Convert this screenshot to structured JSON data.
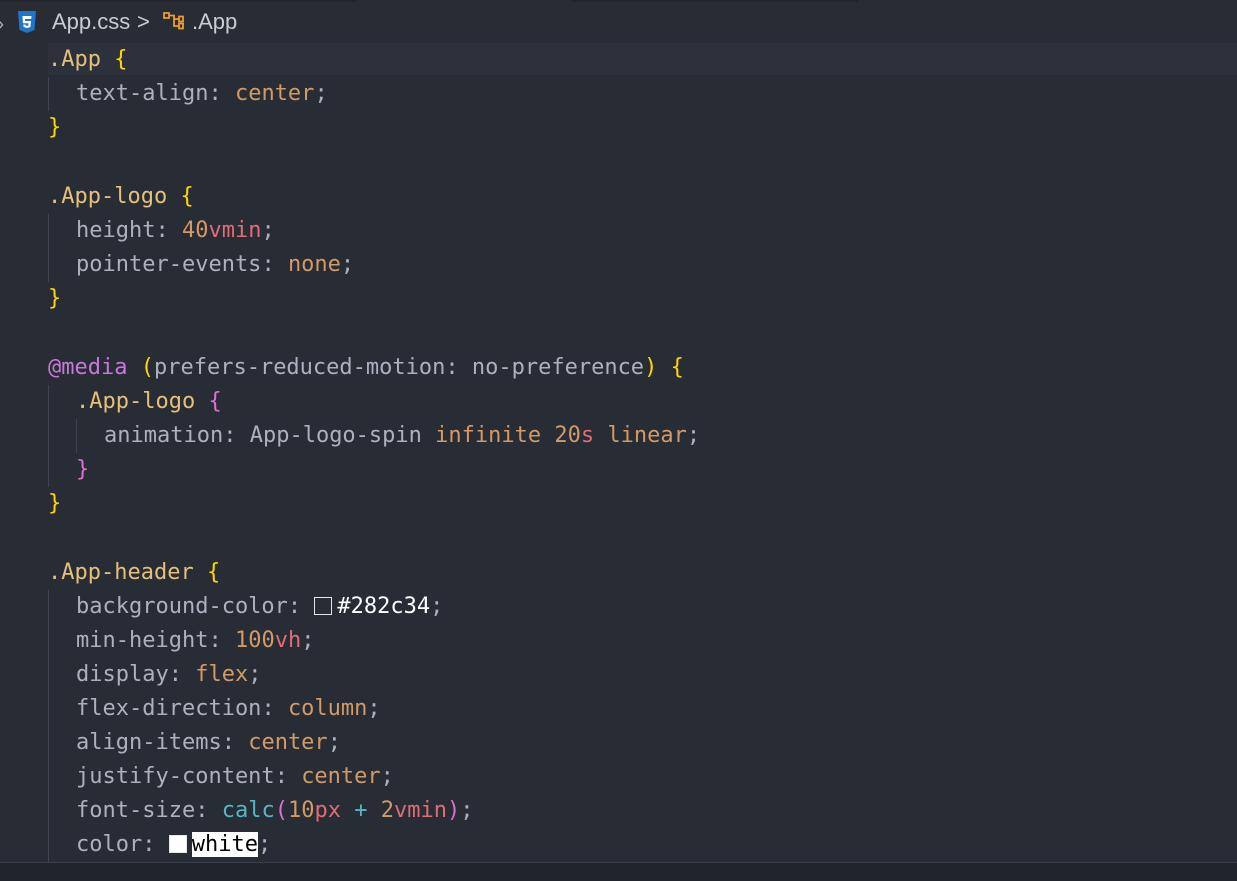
{
  "breadcrumb": {
    "file": "App.css",
    "separator": ">",
    "symbol": ".App"
  },
  "icons": {
    "file_icon": "css3-icon",
    "symbol_icon": "symbol-class-icon",
    "chevron": "chevron-right-icon"
  },
  "colors": {
    "background": "#282c34",
    "selector": "#e5c07b",
    "value": "#d19a66",
    "unit": "#e06c75",
    "at_rule": "#c678dd",
    "function": "#56b6c2",
    "bracket_level1": "#ffd700",
    "bracket_level2": "#da70d6",
    "css_badge": "#1f75c9"
  },
  "code": {
    "l1": [
      ".App",
      " ",
      "{"
    ],
    "l2": [
      "text-align",
      ": ",
      "center",
      ";"
    ],
    "l3": [
      "}"
    ],
    "l5": [
      ".App-logo",
      " ",
      "{"
    ],
    "l6": [
      "height",
      ": ",
      "40",
      "vmin",
      ";"
    ],
    "l7": [
      "pointer-events",
      ": ",
      "none",
      ";"
    ],
    "l8": [
      "}"
    ],
    "l10": [
      "@media",
      " ",
      "(",
      "prefers-reduced-motion: no-preference",
      ")",
      " ",
      "{"
    ],
    "l11": [
      ".App-logo",
      " ",
      "{"
    ],
    "l12": [
      "animation",
      ": ",
      "App-logo-spin",
      " ",
      "infinite",
      " ",
      "20",
      "s",
      " ",
      "linear",
      ";"
    ],
    "l13": [
      "}"
    ],
    "l14": [
      "}"
    ],
    "l16": [
      ".App-header",
      " ",
      "{"
    ],
    "l17": [
      "background-color",
      ": ",
      "#282c34",
      ";"
    ],
    "l18": [
      "min-height",
      ": ",
      "100",
      "vh",
      ";"
    ],
    "l19": [
      "display",
      ": ",
      "flex",
      ";"
    ],
    "l20": [
      "flex-direction",
      ": ",
      "column",
      ";"
    ],
    "l21": [
      "align-items",
      ": ",
      "center",
      ";"
    ],
    "l22": [
      "justify-content",
      ": ",
      "center",
      ";"
    ],
    "l23": [
      "font-size",
      ": ",
      "calc",
      "(",
      "10",
      "px",
      " + ",
      "2",
      "vmin",
      ")",
      ";"
    ],
    "l24": [
      "color",
      ": ",
      "white",
      ";"
    ]
  }
}
